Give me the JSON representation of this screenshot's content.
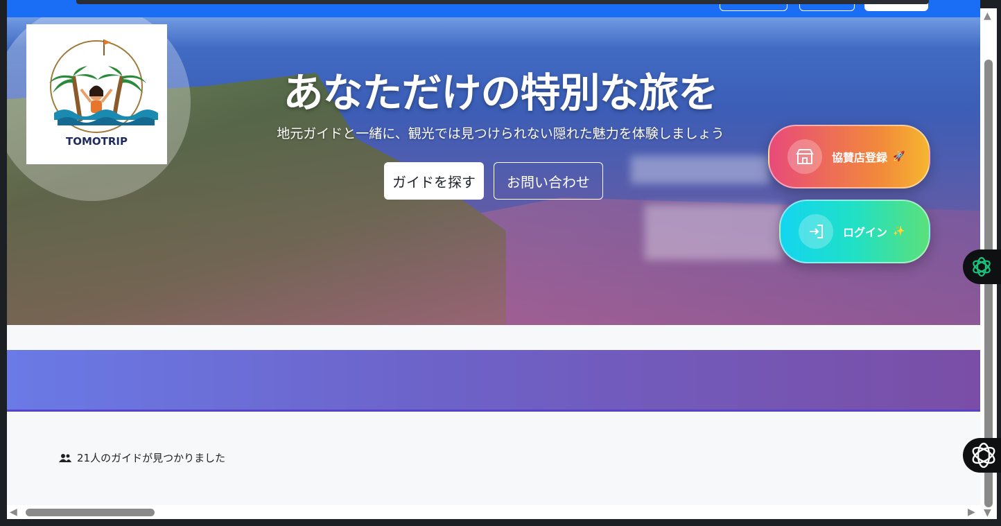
{
  "hero": {
    "title": "あなただけの特別な旅を",
    "subtitle": "地元ガイドと一緒に、観光では見つけられない隠れた魅力を体験しましょう",
    "find_button": "ガイドを探す",
    "contact_button": "お問い合わせ"
  },
  "logo": {
    "text": "TOMOTRIP"
  },
  "floating": {
    "shop_label": "協賛店登録",
    "shop_emoji": "🚀",
    "login_label": "ログイン",
    "login_emoji": "✨"
  },
  "results": {
    "count_text": "21人のガイドが見つかりました"
  },
  "colors": {
    "nav": "#1a6ef5",
    "band_start": "#6a7ae6",
    "band_end": "#7a4ea6",
    "shop_gradient_start": "#e84a7a",
    "shop_gradient_end": "#f5b630",
    "login_gradient_start": "#13d5f0",
    "login_gradient_end": "#5be07a"
  },
  "icons": [
    "users-icon",
    "store-icon",
    "login-icon",
    "chatgpt-icon",
    "perplexity-icon"
  ]
}
